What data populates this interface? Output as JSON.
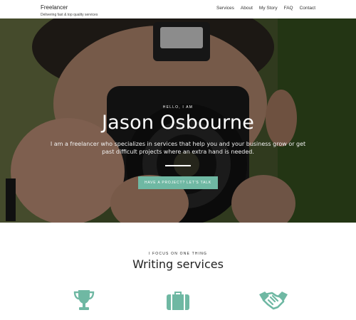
{
  "header": {
    "brand_name": "Freelancer",
    "brand_tagline": "Delivering fast & top quality services",
    "nav": [
      "Services",
      "About",
      "My Story",
      "FAQ",
      "Contact"
    ]
  },
  "hero": {
    "eyebrow": "HELLO, I AM",
    "name": "Jason Osbourne",
    "description": "I am a freelancer who specializes in services that help you and your business grow or get past difficult projects where an extra hand is needed.",
    "cta_label": "HAVE A PROJECT? LET'S TALK"
  },
  "services": {
    "eyebrow": "I FOCUS ON ONE THING",
    "title": "Writing services",
    "icons": [
      "trophy-icon",
      "briefcase-icon",
      "handshake-icon"
    ]
  },
  "colors": {
    "accent": "#6fb8a3",
    "text": "#222222",
    "background": "#ffffff"
  }
}
